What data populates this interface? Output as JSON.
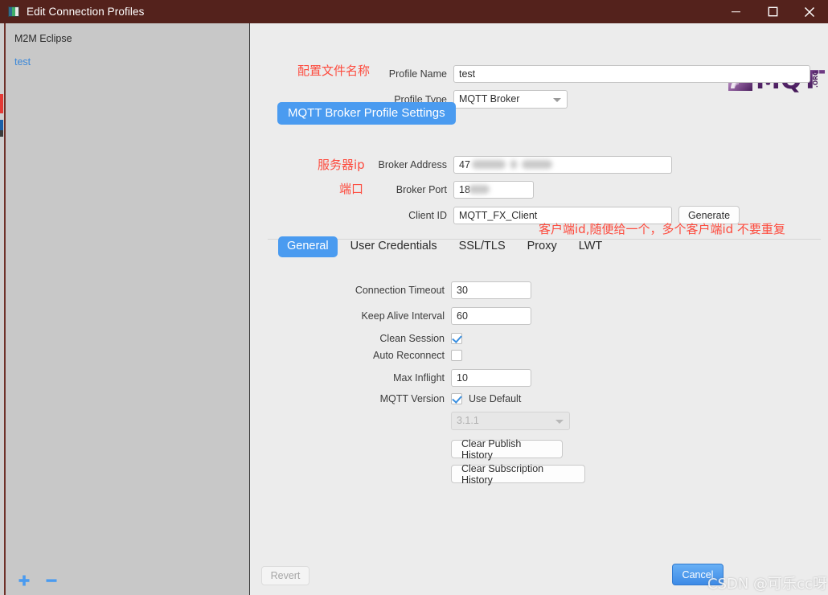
{
  "window": {
    "title": "Edit Connection Profiles",
    "icon": "app-window-icon",
    "titlebar_color": "#54221c",
    "minimize_label": "Minimize",
    "maximize_label": "Maximize",
    "close_label": "Close"
  },
  "sidebar": {
    "items": [
      {
        "label": "M2M Eclipse",
        "type": "group"
      },
      {
        "label": "test",
        "type": "profile"
      }
    ],
    "add_label": "+",
    "remove_label": "−"
  },
  "main": {
    "logo_text": "MQTT",
    "logo_suffix": ".ORG",
    "profile_name_label": "Profile Name",
    "profile_name_value": "test",
    "profile_type_label": "Profile Type",
    "profile_type_value": "MQTT Broker",
    "section_title": "MQTT Broker Profile Settings",
    "broker_address_label": "Broker Address",
    "broker_address_value": "47",
    "broker_port_label": "Broker Port",
    "broker_port_value": "18",
    "client_id_label": "Client ID",
    "client_id_value": "MQTT_FX_Client",
    "generate_label": "Generate"
  },
  "annotations": [
    {
      "text": "配置文件名称",
      "color": "#fd4b3e"
    },
    {
      "text": "服务器ip",
      "color": "#fd4b3e"
    },
    {
      "text": "端口",
      "color": "#fd4b3e"
    },
    {
      "text": "客户端id,随便给一个，多个客户端id 不要重复",
      "color": "#fd4b3e"
    }
  ],
  "tabs": [
    {
      "label": "General",
      "active": true
    },
    {
      "label": "User Credentials",
      "active": false
    },
    {
      "label": "SSL/TLS",
      "active": false
    },
    {
      "label": "Proxy",
      "active": false
    },
    {
      "label": "LWT",
      "active": false
    }
  ],
  "general": {
    "connection_timeout_label": "Connection Timeout",
    "connection_timeout_value": "30",
    "keep_alive_label": "Keep Alive Interval",
    "keep_alive_value": "60",
    "clean_session_label": "Clean Session",
    "clean_session_checked": true,
    "auto_reconnect_label": "Auto Reconnect",
    "auto_reconnect_checked": false,
    "max_inflight_label": "Max Inflight",
    "max_inflight_value": "10",
    "mqtt_version_label": "MQTT Version",
    "use_default_label": "Use Default",
    "use_default_checked": true,
    "version_select_value": "3.1.1",
    "clear_publish_label": "Clear Publish History",
    "clear_subscription_label": "Clear Subscription History"
  },
  "footer": {
    "revert_label": "Revert",
    "cancel_label": "Cancel"
  },
  "watermark": {
    "text": "CSDN @可乐cc呀"
  }
}
